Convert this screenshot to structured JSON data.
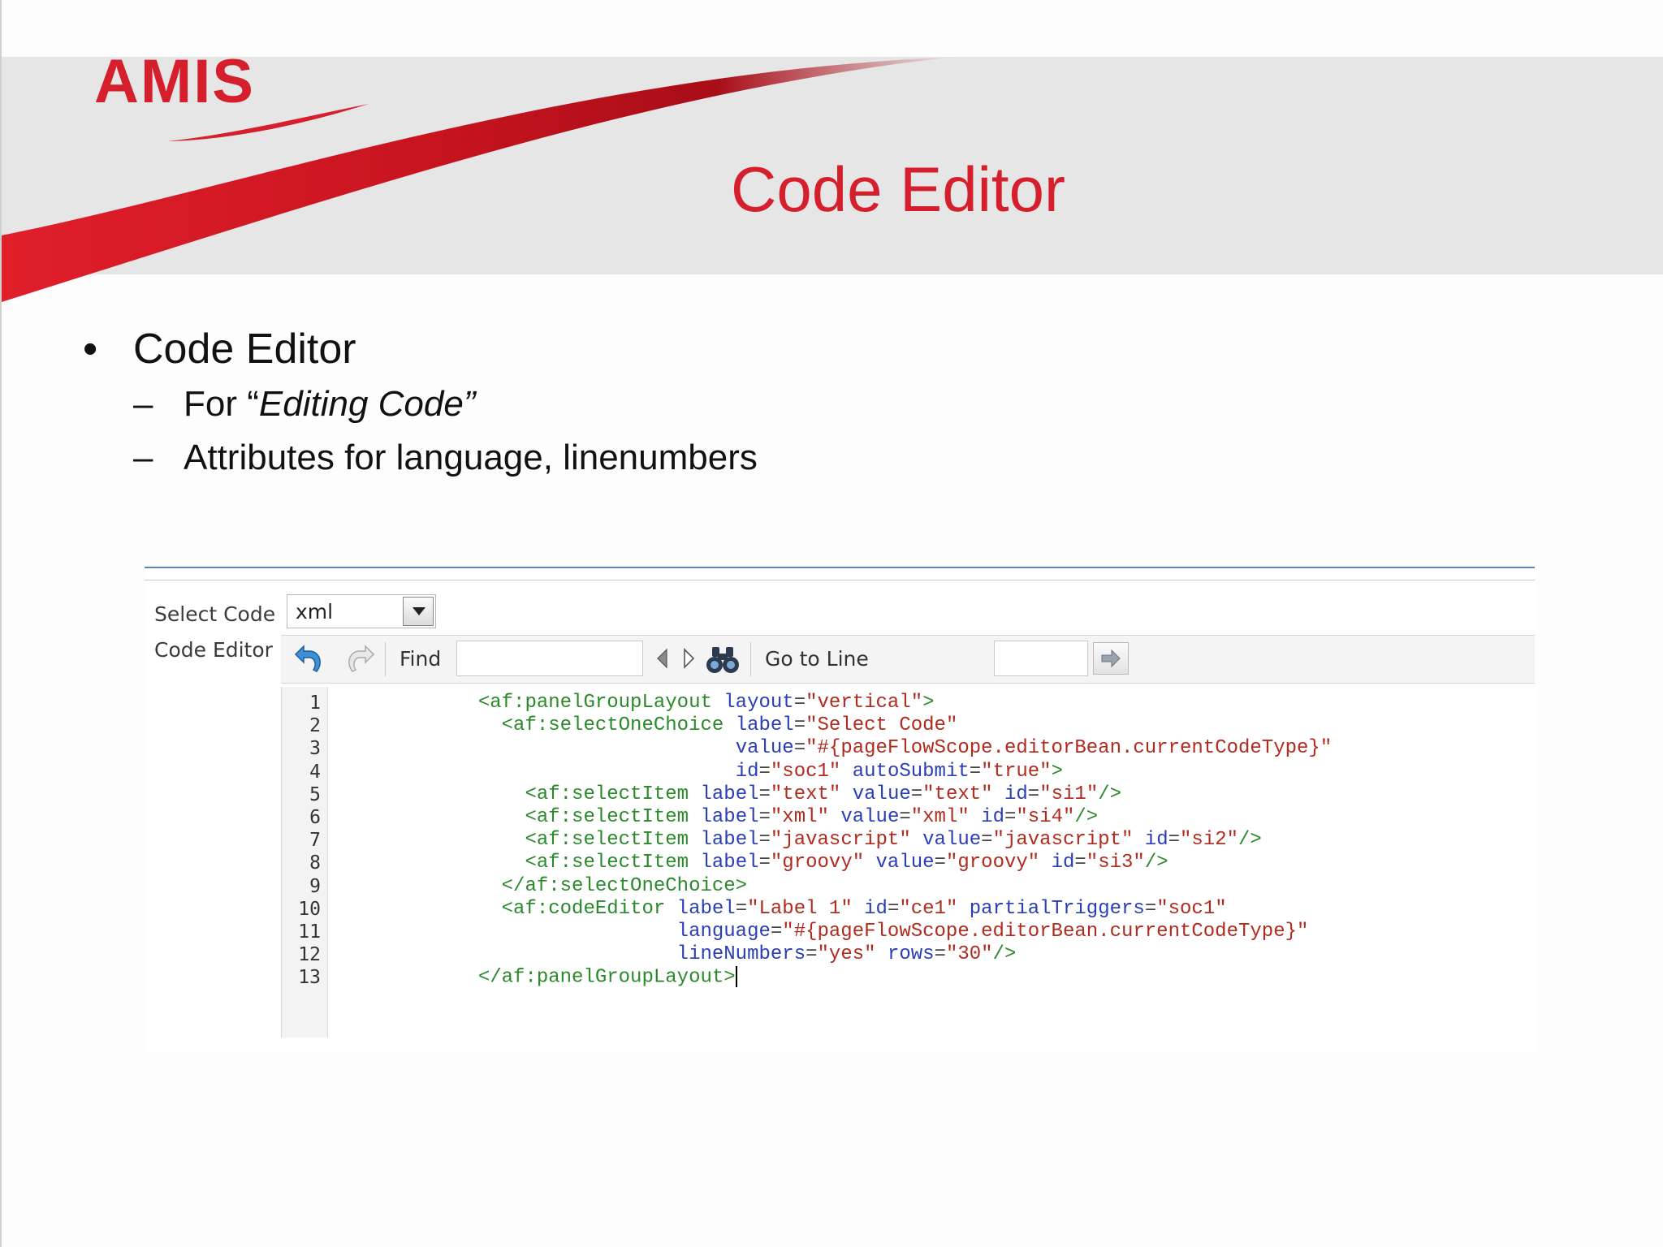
{
  "slide": {
    "logo_text": "AMIS",
    "title": "Code Editor",
    "bullet": "Code Editor",
    "sub1_prefix": "For “",
    "sub1_italic": "Editing Code”",
    "sub2": "Attributes for language, linenumbers"
  },
  "app": {
    "select_label": "Select Code",
    "select_value": "xml",
    "editor_label": "Code Editor",
    "toolbar": {
      "find_label": "Find",
      "find_value": "",
      "goto_label": "Go to Line",
      "goto_value": ""
    },
    "line_numbers": [
      "1",
      "2",
      "3",
      "4",
      "5",
      "6",
      "7",
      "8",
      "9",
      "10",
      "11",
      "12",
      "13"
    ],
    "code_lines": [
      [
        {
          "t": "tag",
          "v": "            <af:panelGroupLayout"
        },
        {
          "t": "pun",
          "v": " "
        },
        {
          "t": "attr",
          "v": "layout"
        },
        {
          "t": "pun",
          "v": "="
        },
        {
          "t": "str",
          "v": "\"vertical\""
        },
        {
          "t": "tag",
          "v": ">"
        }
      ],
      [
        {
          "t": "tag",
          "v": "              <af:selectOneChoice"
        },
        {
          "t": "pun",
          "v": " "
        },
        {
          "t": "attr",
          "v": "label"
        },
        {
          "t": "pun",
          "v": "="
        },
        {
          "t": "str",
          "v": "\"Select Code\""
        }
      ],
      [
        {
          "t": "pun",
          "v": "                                  "
        },
        {
          "t": "attr",
          "v": "value"
        },
        {
          "t": "pun",
          "v": "="
        },
        {
          "t": "str",
          "v": "\"#{pageFlowScope.editorBean.currentCodeType}\""
        }
      ],
      [
        {
          "t": "pun",
          "v": "                                  "
        },
        {
          "t": "attr",
          "v": "id"
        },
        {
          "t": "pun",
          "v": "="
        },
        {
          "t": "str",
          "v": "\"soc1\""
        },
        {
          "t": "pun",
          "v": " "
        },
        {
          "t": "attr",
          "v": "autoSubmit"
        },
        {
          "t": "pun",
          "v": "="
        },
        {
          "t": "str",
          "v": "\"true\""
        },
        {
          "t": "tag",
          "v": ">"
        }
      ],
      [
        {
          "t": "tag",
          "v": "                <af:selectItem"
        },
        {
          "t": "pun",
          "v": " "
        },
        {
          "t": "attr",
          "v": "label"
        },
        {
          "t": "pun",
          "v": "="
        },
        {
          "t": "str",
          "v": "\"text\""
        },
        {
          "t": "pun",
          "v": " "
        },
        {
          "t": "attr",
          "v": "value"
        },
        {
          "t": "pun",
          "v": "="
        },
        {
          "t": "str",
          "v": "\"text\""
        },
        {
          "t": "pun",
          "v": " "
        },
        {
          "t": "attr",
          "v": "id"
        },
        {
          "t": "pun",
          "v": "="
        },
        {
          "t": "str",
          "v": "\"si1\""
        },
        {
          "t": "tag",
          "v": "/>"
        }
      ],
      [
        {
          "t": "tag",
          "v": "                <af:selectItem"
        },
        {
          "t": "pun",
          "v": " "
        },
        {
          "t": "attr",
          "v": "label"
        },
        {
          "t": "pun",
          "v": "="
        },
        {
          "t": "str",
          "v": "\"xml\""
        },
        {
          "t": "pun",
          "v": " "
        },
        {
          "t": "attr",
          "v": "value"
        },
        {
          "t": "pun",
          "v": "="
        },
        {
          "t": "str",
          "v": "\"xml\""
        },
        {
          "t": "pun",
          "v": " "
        },
        {
          "t": "attr",
          "v": "id"
        },
        {
          "t": "pun",
          "v": "="
        },
        {
          "t": "str",
          "v": "\"si4\""
        },
        {
          "t": "tag",
          "v": "/>"
        }
      ],
      [
        {
          "t": "tag",
          "v": "                <af:selectItem"
        },
        {
          "t": "pun",
          "v": " "
        },
        {
          "t": "attr",
          "v": "label"
        },
        {
          "t": "pun",
          "v": "="
        },
        {
          "t": "str",
          "v": "\"javascript\""
        },
        {
          "t": "pun",
          "v": " "
        },
        {
          "t": "attr",
          "v": "value"
        },
        {
          "t": "pun",
          "v": "="
        },
        {
          "t": "str",
          "v": "\"javascript\""
        },
        {
          "t": "pun",
          "v": " "
        },
        {
          "t": "attr",
          "v": "id"
        },
        {
          "t": "pun",
          "v": "="
        },
        {
          "t": "str",
          "v": "\"si2\""
        },
        {
          "t": "tag",
          "v": "/>"
        }
      ],
      [
        {
          "t": "tag",
          "v": "                <af:selectItem"
        },
        {
          "t": "pun",
          "v": " "
        },
        {
          "t": "attr",
          "v": "label"
        },
        {
          "t": "pun",
          "v": "="
        },
        {
          "t": "str",
          "v": "\"groovy\""
        },
        {
          "t": "pun",
          "v": " "
        },
        {
          "t": "attr",
          "v": "value"
        },
        {
          "t": "pun",
          "v": "="
        },
        {
          "t": "str",
          "v": "\"groovy\""
        },
        {
          "t": "pun",
          "v": " "
        },
        {
          "t": "attr",
          "v": "id"
        },
        {
          "t": "pun",
          "v": "="
        },
        {
          "t": "str",
          "v": "\"si3\""
        },
        {
          "t": "tag",
          "v": "/>"
        }
      ],
      [
        {
          "t": "tag",
          "v": "              </af:selectOneChoice>"
        }
      ],
      [
        {
          "t": "tag",
          "v": "              <af:codeEditor"
        },
        {
          "t": "pun",
          "v": " "
        },
        {
          "t": "attr",
          "v": "label"
        },
        {
          "t": "pun",
          "v": "="
        },
        {
          "t": "str",
          "v": "\"Label 1\""
        },
        {
          "t": "pun",
          "v": " "
        },
        {
          "t": "attr",
          "v": "id"
        },
        {
          "t": "pun",
          "v": "="
        },
        {
          "t": "str",
          "v": "\"ce1\""
        },
        {
          "t": "pun",
          "v": " "
        },
        {
          "t": "attr",
          "v": "partialTriggers"
        },
        {
          "t": "pun",
          "v": "="
        },
        {
          "t": "str",
          "v": "\"soc1\""
        }
      ],
      [
        {
          "t": "pun",
          "v": "                             "
        },
        {
          "t": "attr",
          "v": "language"
        },
        {
          "t": "pun",
          "v": "="
        },
        {
          "t": "str",
          "v": "\"#{pageFlowScope.editorBean.currentCodeType}\""
        }
      ],
      [
        {
          "t": "pun",
          "v": "                             "
        },
        {
          "t": "attr",
          "v": "lineNumbers"
        },
        {
          "t": "pun",
          "v": "="
        },
        {
          "t": "str",
          "v": "\"yes\""
        },
        {
          "t": "pun",
          "v": " "
        },
        {
          "t": "attr",
          "v": "rows"
        },
        {
          "t": "pun",
          "v": "="
        },
        {
          "t": "str",
          "v": "\"30\""
        },
        {
          "t": "tag",
          "v": "/>"
        }
      ],
      [
        {
          "t": "tag",
          "v": "            </af:panelGroupLayout>"
        }
      ]
    ]
  },
  "colors": {
    "brand_red": "#d51f2c",
    "tag_green": "#2a8a2a",
    "attr_blue": "#2a3db8",
    "string_red": "#b12a1e"
  }
}
